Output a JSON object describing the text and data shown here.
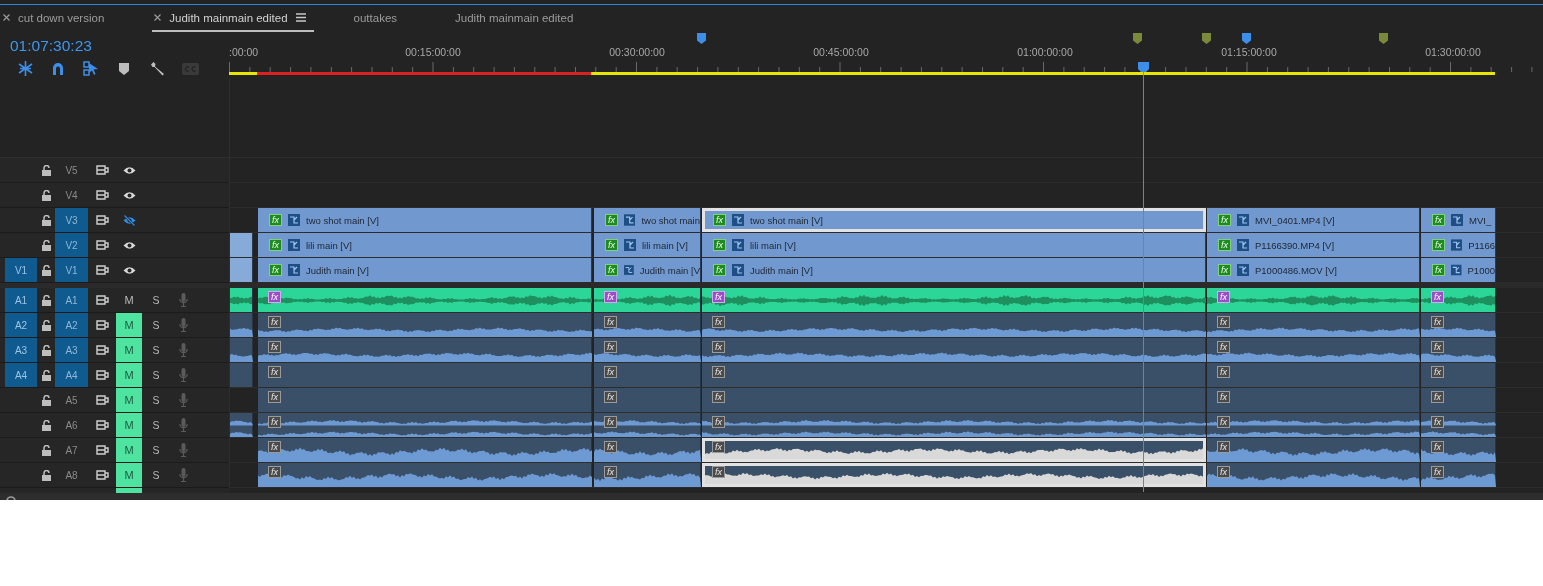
{
  "tabs": [
    {
      "label": "cut down version",
      "closable": true,
      "selected": false
    },
    {
      "label": "Judith mainmain edited",
      "closable": true,
      "selected": true
    },
    {
      "label": "outtakes",
      "closable": false,
      "selected": false
    },
    {
      "label": "Judith mainmain edited",
      "closable": false,
      "selected": false
    }
  ],
  "timecode": "01:07:30:23",
  "tools": [
    {
      "kind": "nest",
      "on": true
    },
    {
      "kind": "snap",
      "on": true
    },
    {
      "kind": "linked",
      "on": true
    },
    {
      "kind": "marker",
      "on": false
    },
    {
      "kind": "wrench",
      "on": false
    },
    {
      "kind": "captions",
      "on": false
    }
  ],
  "ruler": {
    "labels": [
      ":00:00",
      "00:15:00:00",
      "00:30:00:00",
      "00:45:00:00",
      "01:00:00:00",
      "01:15:00:00",
      "01:30:00:00"
    ],
    "markers": [
      {
        "color": "#3d8ee8"
      },
      {
        "color": "#7a8a3a"
      },
      {
        "color": "#7a8a3a"
      },
      {
        "color": "#3d8ee8"
      },
      {
        "color": "#7a8a3a"
      }
    ]
  },
  "render_bar": [
    {
      "color": "#e6e600"
    },
    {
      "color": "#dd2020"
    },
    {
      "color": "#e6e600"
    }
  ],
  "video_tracks": [
    {
      "name": "V5",
      "targeted": false,
      "visible": true
    },
    {
      "name": "V4",
      "targeted": false,
      "visible": true
    },
    {
      "name": "V3",
      "targeted": true,
      "visible": false,
      "clips": [
        {
          "kind": "empty"
        },
        {
          "kind": "clip",
          "badge": "fx",
          "fx_applied": true,
          "label": "two shot main [V]",
          "selected": false
        },
        {
          "kind": "clip",
          "badge": "fx",
          "fx_applied": true,
          "label": "two shot main",
          "selected": false
        },
        {
          "kind": "clip",
          "badge": "fx",
          "fx_applied": true,
          "label": "two shot main [V]",
          "selected": true
        },
        {
          "kind": "clip",
          "badge": "fx",
          "fx_applied": true,
          "label": "MVI_0401.MP4 [V]",
          "selected": false
        },
        {
          "kind": "clip",
          "badge": "fx",
          "fx_applied": true,
          "label": "MVI_",
          "selected": false
        }
      ]
    },
    {
      "name": "V2",
      "targeted": true,
      "visible": true,
      "clips": [
        {
          "kind": "fragment"
        },
        {
          "kind": "clip",
          "badge": "fx",
          "fx_applied": true,
          "label": "lili main [V]",
          "selected": false
        },
        {
          "kind": "clip",
          "badge": "fx",
          "fx_applied": true,
          "label": "lili main [V]",
          "selected": false
        },
        {
          "kind": "clip",
          "badge": "fx",
          "fx_applied": true,
          "label": "lili main [V]",
          "selected": false
        },
        {
          "kind": "clip",
          "badge": "fx",
          "fx_applied": true,
          "label": "P1166390.MP4 [V]",
          "selected": false
        },
        {
          "kind": "clip",
          "badge": "fx",
          "fx_applied": true,
          "label": "P1166",
          "selected": false
        }
      ]
    },
    {
      "name": "V1",
      "source": "V1",
      "targeted": true,
      "visible": true,
      "clips": [
        {
          "kind": "fragment"
        },
        {
          "kind": "clip",
          "badge": "fx",
          "fx_applied": true,
          "label": "Judith main [V]",
          "selected": false
        },
        {
          "kind": "clip",
          "badge": "fx",
          "fx_applied": true,
          "label": "Judith main [V",
          "selected": false
        },
        {
          "kind": "clip",
          "badge": "fx",
          "fx_applied": true,
          "label": "Judith main [V]",
          "selected": false
        },
        {
          "kind": "clip",
          "badge": "fx",
          "fx_applied": true,
          "label": "P1000486.MOV [V]",
          "selected": false
        },
        {
          "kind": "clip",
          "badge": "fx",
          "fx_applied": true,
          "label": "P1000",
          "selected": false
        }
      ]
    }
  ],
  "audio_tracks": [
    {
      "name": "A1",
      "source": "A1",
      "targeted": true,
      "muted": false,
      "mute_label": "M",
      "solo_label": "S",
      "color": "#2cd598",
      "kind": "center",
      "clips": [
        {
          "kind": "fragment"
        },
        {
          "kind": "clip",
          "badge": "fx",
          "fx_applied": true,
          "selected": false
        },
        {
          "kind": "clip",
          "badge": "fx",
          "fx_applied": true,
          "selected": false
        },
        {
          "kind": "clip",
          "badge": "fx",
          "fx_applied": true,
          "selected": false
        },
        {
          "kind": "clip",
          "badge": "fx",
          "fx_applied": true,
          "selected": false
        },
        {
          "kind": "clip",
          "badge": "fx",
          "fx_applied": true,
          "selected": false
        }
      ]
    },
    {
      "name": "A2",
      "source": "A2",
      "targeted": true,
      "muted": true,
      "mute_label": "M",
      "solo_label": "S",
      "color": "#3a4f68",
      "kind": "low",
      "clips": [
        {
          "kind": "fragment"
        },
        {
          "kind": "clip",
          "badge": "fx",
          "fx_applied": false,
          "selected": false
        },
        {
          "kind": "clip",
          "badge": "fx",
          "fx_applied": false,
          "selected": false
        },
        {
          "kind": "clip",
          "badge": "fx",
          "fx_applied": false,
          "selected": false
        },
        {
          "kind": "clip",
          "badge": "fx",
          "fx_applied": false,
          "selected": false
        },
        {
          "kind": "clip",
          "badge": "fx",
          "fx_applied": false,
          "selected": false
        }
      ]
    },
    {
      "name": "A3",
      "source": "A3",
      "targeted": true,
      "muted": true,
      "mute_label": "M",
      "solo_label": "S",
      "color": "#3a4f68",
      "kind": "low",
      "clips": [
        {
          "kind": "fragment"
        },
        {
          "kind": "clip",
          "badge": "fx",
          "fx_applied": false,
          "selected": false
        },
        {
          "kind": "clip",
          "badge": "fx",
          "fx_applied": false,
          "selected": false
        },
        {
          "kind": "clip",
          "badge": "fx",
          "fx_applied": false,
          "selected": false
        },
        {
          "kind": "clip",
          "badge": "fx",
          "fx_applied": false,
          "selected": false
        },
        {
          "kind": "clip",
          "badge": "fx",
          "fx_applied": false,
          "selected": false
        }
      ]
    },
    {
      "name": "A4",
      "source": "A4",
      "targeted": true,
      "muted": true,
      "mute_label": "M",
      "solo_label": "S",
      "color": "#3a4f68",
      "kind": "none",
      "clips": [
        {
          "kind": "fragment"
        },
        {
          "kind": "clip",
          "badge": "fx",
          "fx_applied": false,
          "selected": false
        },
        {
          "kind": "clip",
          "badge": "fx",
          "fx_applied": false,
          "selected": false
        },
        {
          "kind": "clip",
          "badge": "fx",
          "fx_applied": false,
          "selected": false
        },
        {
          "kind": "clip",
          "badge": "fx",
          "fx_applied": false,
          "selected": false
        },
        {
          "kind": "clip",
          "badge": "fx",
          "fx_applied": false,
          "selected": false
        }
      ]
    },
    {
      "name": "A5",
      "targeted": false,
      "muted": true,
      "mute_label": "M",
      "solo_label": "S",
      "color": "#3a4f68",
      "kind": "none",
      "clips": [
        {
          "kind": "empty"
        },
        {
          "kind": "clip",
          "badge": "fx",
          "fx_applied": false,
          "selected": false
        },
        {
          "kind": "clip",
          "badge": "fx",
          "fx_applied": false,
          "selected": false
        },
        {
          "kind": "clip",
          "badge": "fx",
          "fx_applied": false,
          "selected": false
        },
        {
          "kind": "clip",
          "badge": "fx",
          "fx_applied": false,
          "selected": false
        },
        {
          "kind": "clip",
          "badge": "fx",
          "fx_applied": false,
          "selected": false
        }
      ]
    },
    {
      "name": "A6",
      "targeted": false,
      "muted": true,
      "mute_label": "M",
      "solo_label": "S",
      "color": "#3a4f68",
      "kind": "stereo",
      "clips": [
        {
          "kind": "fragment"
        },
        {
          "kind": "clip",
          "badge": "fx",
          "fx_applied": false,
          "selected": false
        },
        {
          "kind": "clip",
          "badge": "fx",
          "fx_applied": false,
          "selected": false
        },
        {
          "kind": "clip",
          "badge": "fx",
          "fx_applied": false,
          "selected": false
        },
        {
          "kind": "clip",
          "badge": "fx",
          "fx_applied": false,
          "selected": false
        },
        {
          "kind": "clip",
          "badge": "fx",
          "fx_applied": false,
          "selected": false
        }
      ]
    },
    {
      "name": "A7",
      "targeted": false,
      "muted": true,
      "mute_label": "M",
      "solo_label": "S",
      "color": "#3a4f68",
      "kind": "loud",
      "clips": [
        {
          "kind": "empty"
        },
        {
          "kind": "clip",
          "badge": "fx",
          "fx_applied": false,
          "selected": false
        },
        {
          "kind": "clip",
          "badge": "fx",
          "fx_applied": false,
          "selected": false
        },
        {
          "kind": "clip",
          "badge": "fx",
          "fx_applied": false,
          "selected": true
        },
        {
          "kind": "clip",
          "badge": "fx",
          "fx_applied": false,
          "selected": false
        },
        {
          "kind": "clip",
          "badge": "fx",
          "fx_applied": false,
          "selected": false
        }
      ]
    },
    {
      "name": "A8",
      "targeted": false,
      "muted": true,
      "mute_label": "M",
      "solo_label": "S",
      "color": "#3a4f68",
      "kind": "loud",
      "clips": [
        {
          "kind": "empty"
        },
        {
          "kind": "clip",
          "badge": "fx",
          "fx_applied": false,
          "selected": false
        },
        {
          "kind": "clip",
          "badge": "fx",
          "fx_applied": false,
          "selected": false
        },
        {
          "kind": "clip",
          "badge": "fx",
          "fx_applied": false,
          "selected": true
        },
        {
          "kind": "clip",
          "badge": "fx",
          "fx_applied": false,
          "selected": false
        },
        {
          "kind": "clip",
          "badge": "fx",
          "fx_applied": false,
          "selected": false
        }
      ]
    }
  ]
}
